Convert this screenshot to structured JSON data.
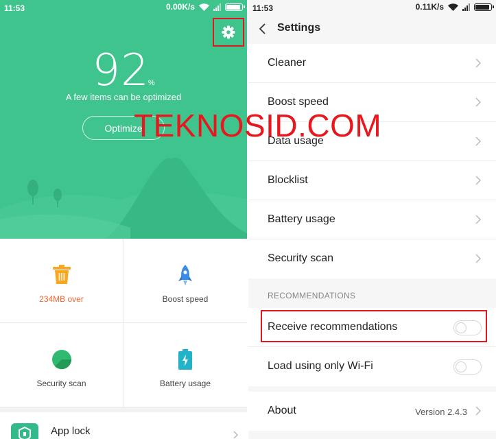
{
  "left_screen": {
    "status": {
      "time": "11:53",
      "speed": "0.00K/s",
      "battery_level": 0.85
    },
    "score": {
      "value": "92",
      "unit": "%"
    },
    "subtitle": "A few items can be optimized",
    "optimize_label": "Optimize",
    "tiles": [
      {
        "label": "234MB over",
        "icon": "trash-icon",
        "color": "#f7a823",
        "label_color": "#f0632f"
      },
      {
        "label": "Boost speed",
        "icon": "rocket-icon",
        "color": "#3b8be8"
      },
      {
        "label": "Security scan",
        "icon": "security-scan-icon",
        "color": "#2fba6f"
      },
      {
        "label": "Battery usage",
        "icon": "battery-icon",
        "color": "#23b3c9"
      }
    ],
    "app_lock_label": "App lock",
    "accent": "#3fc48e"
  },
  "right_screen": {
    "status": {
      "time": "11:53",
      "speed": "0.11K/s",
      "battery_level": 0.85
    },
    "title": "Settings",
    "items": [
      {
        "label": "Cleaner"
      },
      {
        "label": "Boost speed"
      },
      {
        "label": "Data usage"
      },
      {
        "label": "Blocklist"
      },
      {
        "label": "Battery usage"
      },
      {
        "label": "Security scan"
      }
    ],
    "recommendations_header": "RECOMMENDATIONS",
    "toggles": [
      {
        "label": "Receive recommendations",
        "on": false
      },
      {
        "label": "Load using only Wi-Fi",
        "on": false
      }
    ],
    "about": {
      "label": "About",
      "value": "Version 2.4.3"
    }
  },
  "watermark": "TEKNOSID.COM",
  "highlight_color": "#e0171d"
}
